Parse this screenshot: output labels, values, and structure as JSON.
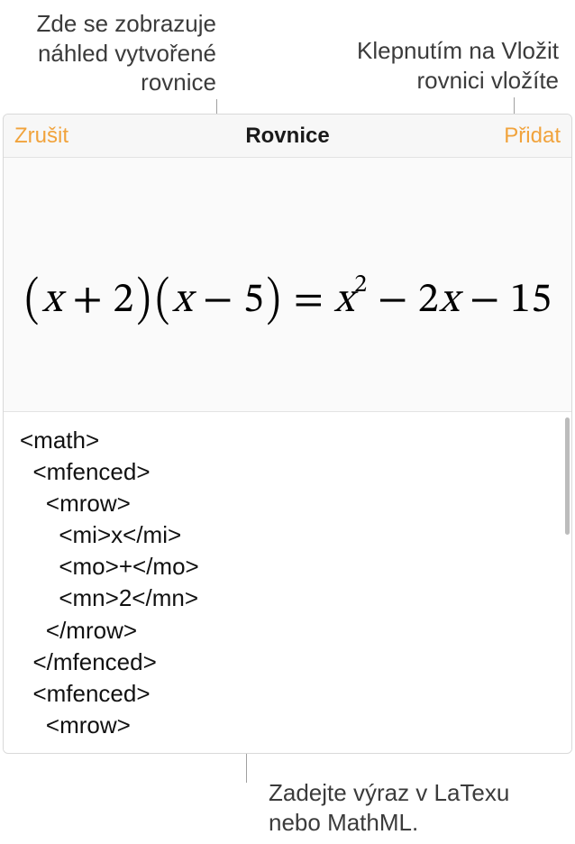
{
  "callouts": {
    "top_left": "Zde se zobrazuje náhled vytvořené rovnice",
    "top_right": "Klepnutím na Vložit rovnici vložíte",
    "bottom": "Zadejte výraz v LaTexu nebo MathML."
  },
  "panel": {
    "cancel_label": "Zrušit",
    "title": "Rovnice",
    "insert_label": "Přidat"
  },
  "equation": {
    "parts": {
      "lp1": "(",
      "x1": "x",
      "plus": " + ",
      "n2": "2",
      "rp1": ")",
      "lp2": "(",
      "x2": "x",
      "minus": " − ",
      "n5": "5",
      "rp2": ")",
      "eq": " = ",
      "x3": "x",
      "sup2": "2",
      "minus2": " − 2",
      "x4": "x",
      "tail": " − 15"
    }
  },
  "code_text": "<math>\n  <mfenced>\n    <mrow>\n      <mi>x</mi>\n      <mo>+</mo>\n      <mn>2</mn>\n    </mrow>\n  </mfenced>\n  <mfenced>\n    <mrow>"
}
